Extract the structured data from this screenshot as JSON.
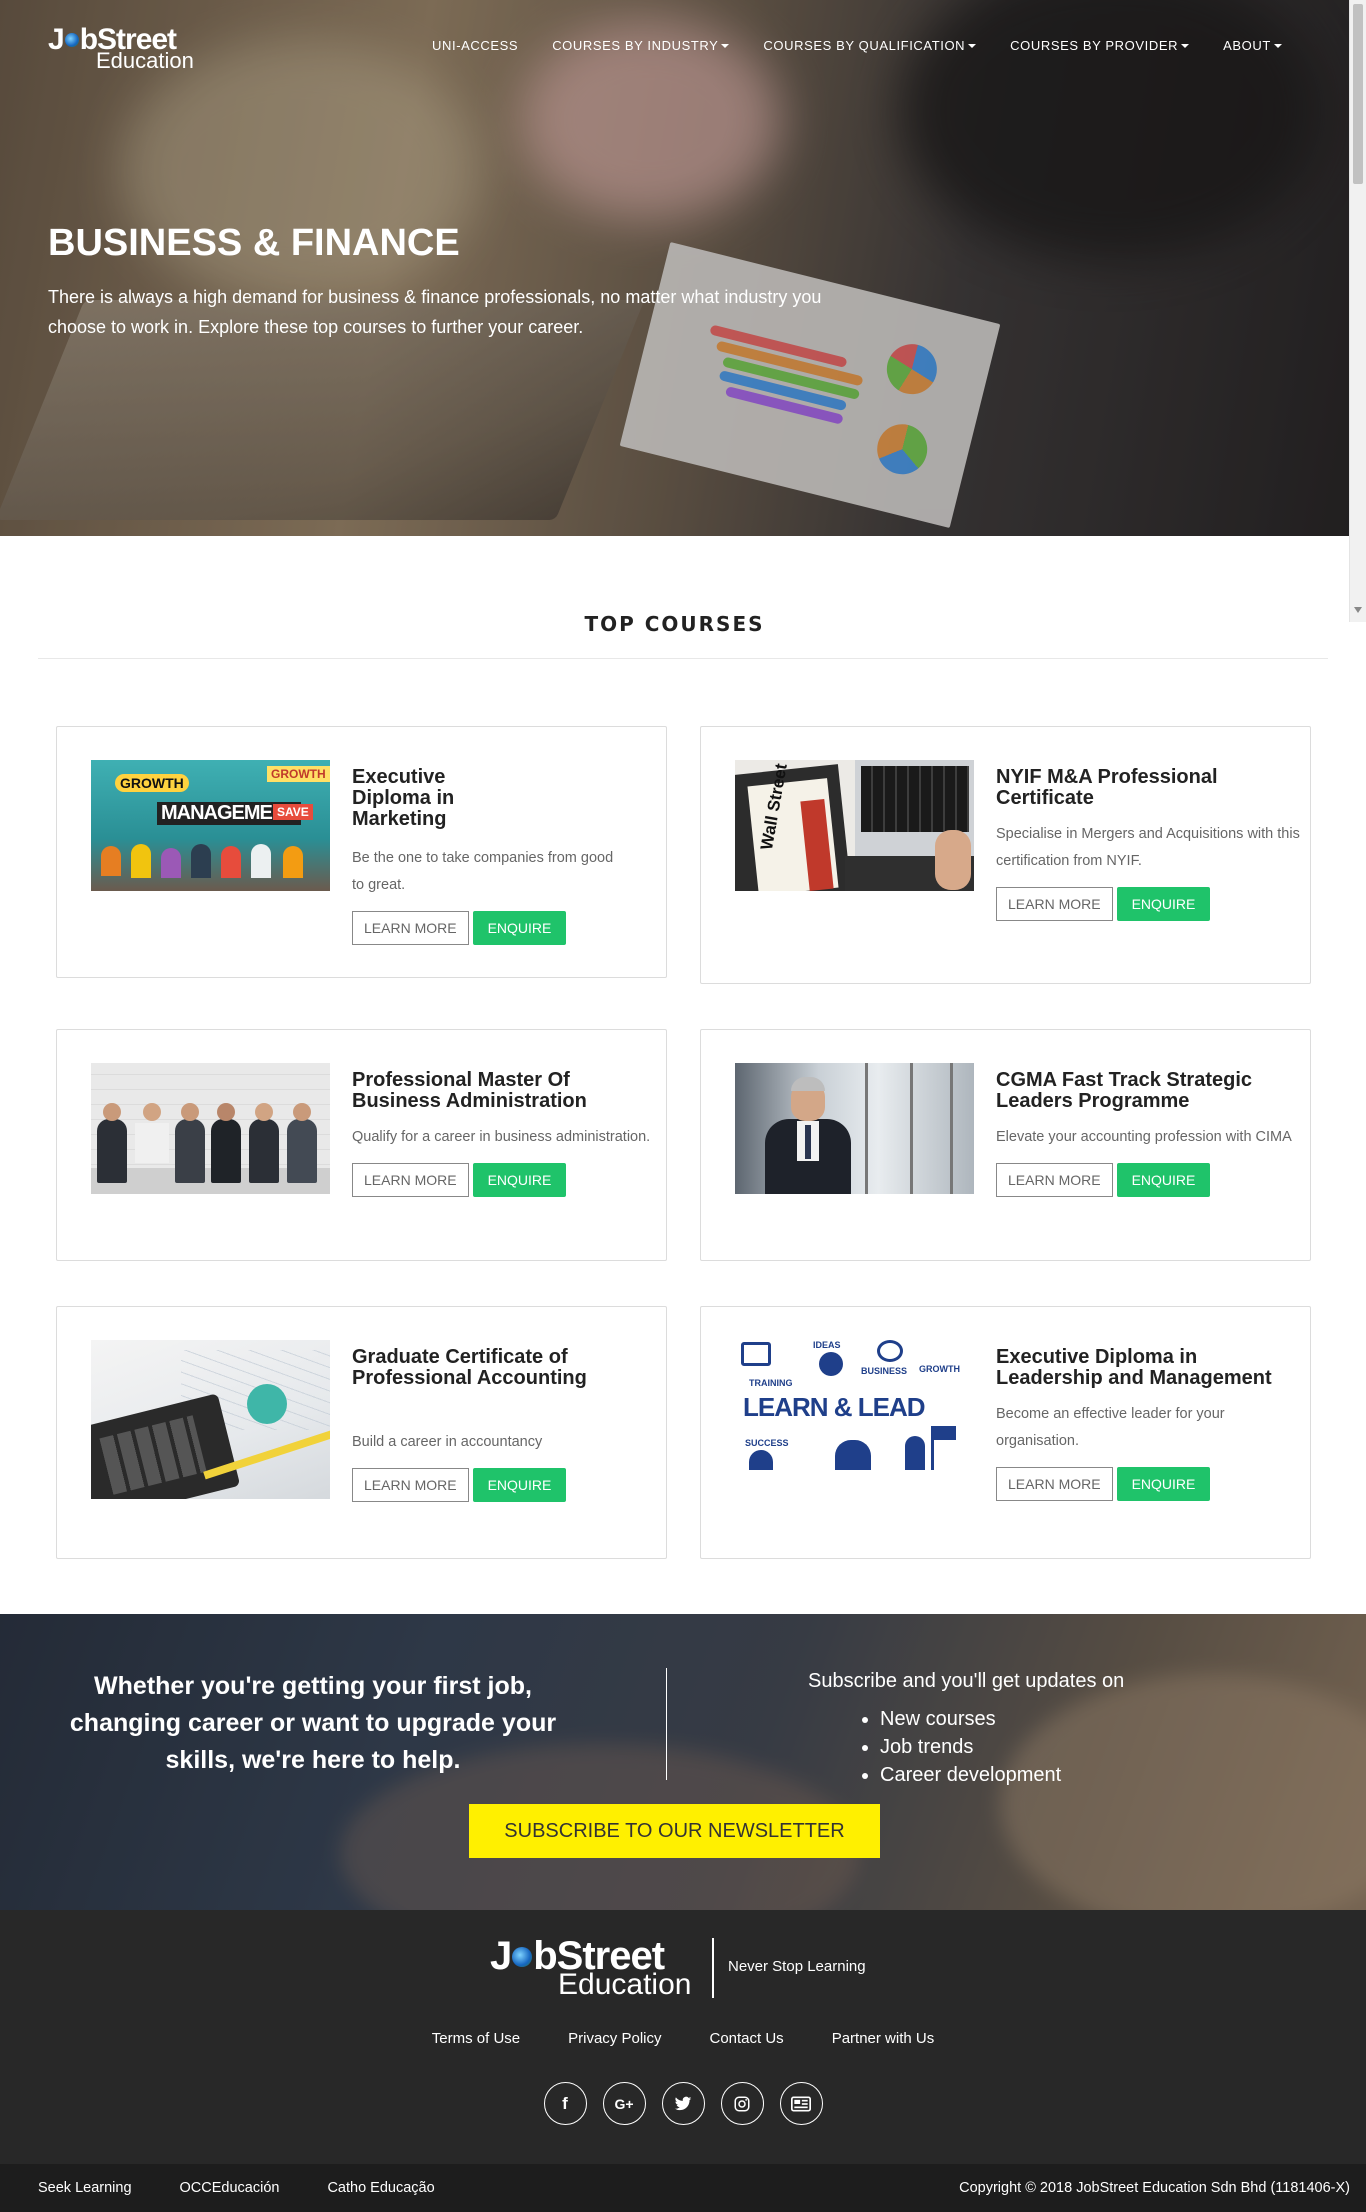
{
  "brand": {
    "logo_main_pre": "J",
    "logo_main_post": "bStreet",
    "logo_sub": "Education",
    "tagline": "Never Stop Learning"
  },
  "nav": [
    {
      "label": "UNI-ACCESS",
      "has_caret": false
    },
    {
      "label": "COURSES BY INDUSTRY",
      "has_caret": true
    },
    {
      "label": "COURSES BY QUALIFICATION",
      "has_caret": true
    },
    {
      "label": "COURSES BY PROVIDER",
      "has_caret": true
    },
    {
      "label": "ABOUT",
      "has_caret": true
    }
  ],
  "hero": {
    "title": "BUSINESS & FINANCE",
    "description": "There is always a high demand for business & finance professionals, no matter what industry you choose to work in. Explore these top courses to further your career."
  },
  "top_courses": {
    "heading": "TOP COURSES",
    "learn_more_label": "LEARN MORE",
    "enquire_label": "ENQUIRE",
    "courses": [
      {
        "title": "Executive Diploma in Marketing",
        "description": "Be the one to take companies from good to great."
      },
      {
        "title": "NYIF M&A Professional Certificate",
        "description": "Specialise in Mergers and Acquisitions with this certification from NYIF."
      },
      {
        "title": "Professional Master Of Business Administration",
        "description": "Qualify for a career in business administration."
      },
      {
        "title": "CGMA Fast Track Strategic Leaders Programme",
        "description": "Elevate your accounting profession with CIMA"
      },
      {
        "title": "Graduate Certificate of Professional Accounting",
        "description": "Build a career in accountancy"
      },
      {
        "title": "Executive Diploma in Leadership and Management",
        "description": "Become an effective leader for your organisation."
      }
    ],
    "image_text": {
      "marketing": {
        "growth": "GROWTH",
        "management": "MANAGEMENT",
        "save": "SAVE"
      },
      "nyif": {
        "book": "Wall Street"
      },
      "leadership": {
        "learn_lead": "LEARN & LEAD",
        "training": "TRAINING",
        "ideas": "IDEAS",
        "business": "BUSINESS",
        "growth": "GROWTH",
        "success": "SUCCESS"
      }
    }
  },
  "newsletter": {
    "pitch": "Whether you're getting your first job, changing career or want to upgrade your skills, we're here to help.",
    "subscribe_intro": "Subscribe and you'll get updates on",
    "items": [
      "New courses",
      "Job trends",
      "Career development"
    ],
    "button_label": "SUBSCRIBE TO OUR NEWSLETTER"
  },
  "footer": {
    "links": [
      "Terms of Use",
      "Privacy Policy",
      "Contact Us",
      "Partner with Us"
    ],
    "social": [
      {
        "icon": "facebook-icon",
        "glyph": "f"
      },
      {
        "icon": "google-plus-icon",
        "glyph": "G+"
      },
      {
        "icon": "twitter-icon",
        "glyph": "🐦"
      },
      {
        "icon": "instagram-icon",
        "glyph": "◎"
      },
      {
        "icon": "news-icon",
        "glyph": "▤"
      }
    ],
    "bottom_links": [
      "Seek Learning",
      "OCCEducación",
      "Catho Educação"
    ],
    "copyright": "Copyright © 2018 JobStreet Education Sdn Bhd (1181406-X)"
  },
  "colors": {
    "accent_green": "#1fc36a",
    "subscribe_yellow": "#fff000",
    "footer_bg": "#282828"
  }
}
